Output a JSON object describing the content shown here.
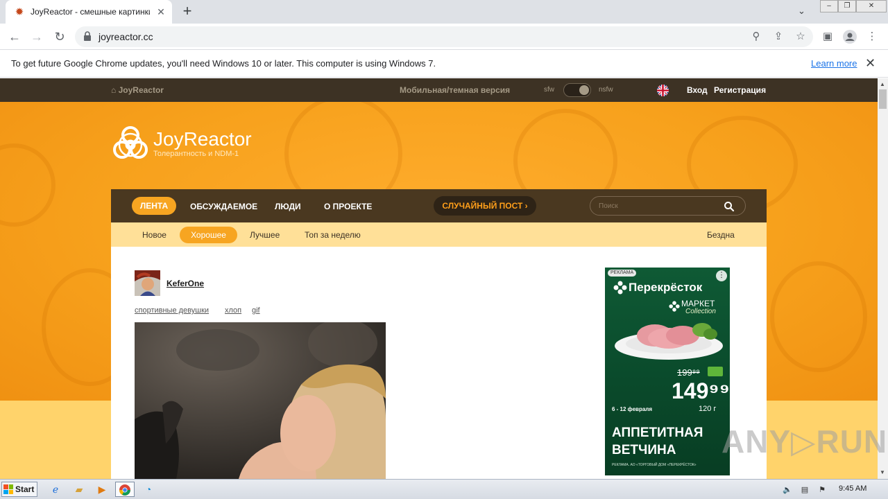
{
  "browser": {
    "tab_title": "JoyReactor - смешные картинки и",
    "new_tab_symbol": "+",
    "url": "joyreactor.cc",
    "infobar_text": "To get future Google Chrome updates, you'll need Windows 10 or later. This computer is using Windows 7.",
    "infobar_link": "Learn more"
  },
  "site": {
    "topbar": {
      "home_label": "JoyReactor",
      "mobile_label": "Мобильная/темная версия",
      "sfw": "sfw",
      "nsfw": "nsfw",
      "login": "Вход",
      "register": "Регистрация"
    },
    "logo": {
      "name": "JoyReactor",
      "tagline": "Толерантность и NDM-1"
    },
    "main_nav": {
      "active": "ЛЕНТА",
      "items": [
        "ОБСУЖДАЕМОЕ",
        "ЛЮДИ",
        "О ПРОЕКТЕ"
      ],
      "random_post": "СЛУЧАЙНЫЙ ПОСТ ›",
      "search_placeholder": "Поиск"
    },
    "sub_nav": {
      "items": [
        "Новое",
        "Хорошее",
        "Лучшее",
        "Топ за неделю"
      ],
      "active": "Хорошее",
      "right": "Бездна"
    },
    "post": {
      "username": "KeferOne",
      "tags": [
        "спортивные девушки",
        "хлоп",
        "gif"
      ]
    },
    "ad": {
      "label": "РЕКЛАМА",
      "brand": "Перекрёсток",
      "market": "МАРКЕТ",
      "collection": "Collection",
      "old_price": "199⁹⁹",
      "new_price": "149⁹⁹",
      "weight": "120 г",
      "dates": "6 - 12 февраля",
      "headline": "АППЕТИТНАЯ ВЕТЧИНА",
      "fine_print": "РЕКЛАМА. АО «ТОРГОВЫЙ ДОМ «ПЕРЕКРЁСТОК»"
    }
  },
  "watermark": "ANY▷RUN",
  "taskbar": {
    "start_label": "Start",
    "time": "9:45 AM"
  },
  "colors": {
    "topbar": "#3d3224",
    "banner": "#f7a11c",
    "nav": "#4a3820",
    "accent": "#f7a521",
    "subnav": "#ffe098"
  }
}
